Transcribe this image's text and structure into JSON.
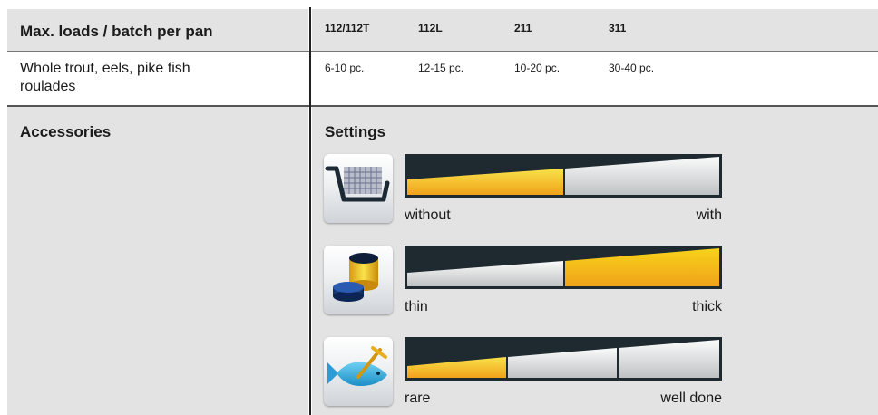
{
  "table": {
    "header": {
      "title": "Max. loads / batch per pan",
      "columns": [
        "112/112T",
        "112L",
        "211",
        "311"
      ]
    },
    "row": {
      "label": "Whole trout, eels, pike fish roulades",
      "label_line1": "Whole trout, eels, pike fish",
      "label_line2": "roulades",
      "values": [
        "6-10 pc.",
        "12-15 pc.",
        "10-20 pc.",
        "30-40 pc."
      ]
    }
  },
  "accessories": {
    "title": "Accessories"
  },
  "settings": {
    "title": "Settings",
    "items": [
      {
        "icon": "basket-icon",
        "left_label": "without",
        "right_label": "with",
        "segments": 2,
        "filled_segment": 1
      },
      {
        "icon": "layer-thickness-icon",
        "left_label": "thin",
        "right_label": "thick",
        "segments": 2,
        "filled_segment": 2
      },
      {
        "icon": "fish-probe-icon",
        "left_label": "rare",
        "right_label": "well done",
        "segments": 3,
        "filled_segment": 1
      }
    ]
  },
  "colors": {
    "panel_bg": "#e3e3e3",
    "bar_dark": "#1e2a30",
    "fill_yellow": "#f7d31a",
    "fill_orange": "#f0a21a"
  }
}
